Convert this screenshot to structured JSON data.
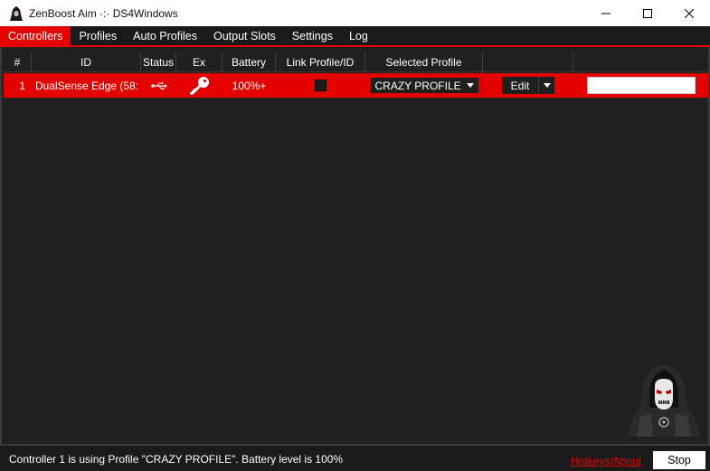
{
  "window": {
    "title": "ZenBoost Aim ·:· DS4Windows",
    "icon": "hooded-figure-icon",
    "minimize_icon": "minimize-icon",
    "maximize_icon": "maximize-icon",
    "close_icon": "close-icon"
  },
  "tabs": [
    {
      "label": "Controllers",
      "active": true
    },
    {
      "label": "Profiles",
      "active": false
    },
    {
      "label": "Auto Profiles",
      "active": false
    },
    {
      "label": "Output Slots",
      "active": false
    },
    {
      "label": "Settings",
      "active": false
    },
    {
      "label": "Log",
      "active": false
    }
  ],
  "controllers_table": {
    "columns": [
      "#",
      "ID",
      "Status",
      "Ex",
      "Battery",
      "Link Profile/ID",
      "Selected Profile",
      "",
      ""
    ],
    "rows": [
      {
        "index": "1",
        "id": "DualSense Edge (58:",
        "status_icon": "usb-icon",
        "ex_icon": "key-icon",
        "battery": "100%+",
        "link_profile": false,
        "selected_profile": "CRAZY PROFILE",
        "edit_label": "Edit",
        "text_value": ""
      }
    ]
  },
  "status_bar": {
    "message": "Controller 1 is using Profile \"CRAZY PROFILE\". Battery level is 100%",
    "hotkeys_link": "Hotkeys/About",
    "stop_label": "Stop"
  },
  "colors": {
    "accent": "#e60000",
    "background": "#202020",
    "link": "#e60000"
  },
  "mascot_icon": "hooded-mask-mascot-icon"
}
